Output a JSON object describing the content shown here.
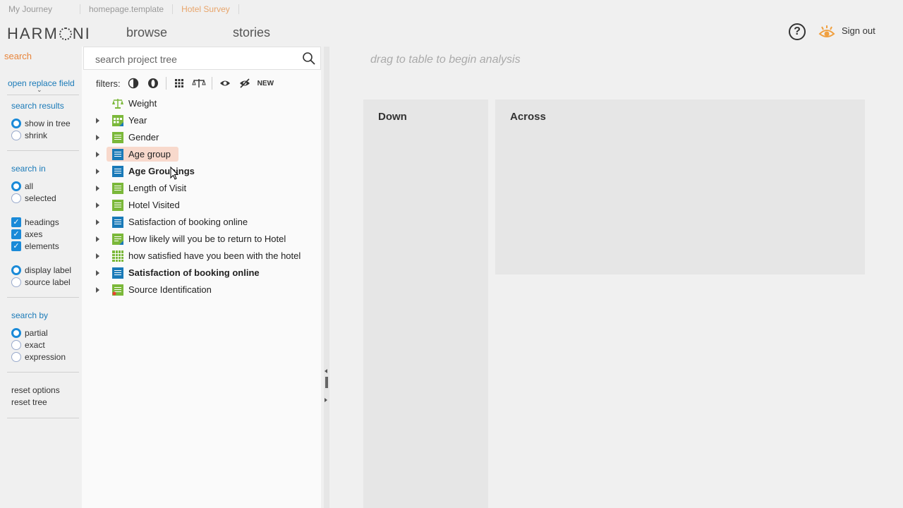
{
  "breadcrumbs": [
    "My Journey",
    "homepage.template",
    "Hotel Survey"
  ],
  "header": {
    "logo": "HARMONI",
    "nav": {
      "browse": "browse",
      "stories": "stories"
    },
    "help_icon": "question-circle-icon",
    "help_glyph": "?",
    "sign_out": "Sign out"
  },
  "options": {
    "title": "search",
    "open_replace": "open replace field",
    "search_results": {
      "heading": "search results",
      "items": [
        {
          "label": "show in tree",
          "selected": true
        },
        {
          "label": "shrink",
          "selected": false
        }
      ]
    },
    "search_in": {
      "heading": "search in",
      "items": [
        {
          "label": "all",
          "selected": true
        },
        {
          "label": "selected",
          "selected": false
        }
      ],
      "checks": [
        {
          "label": "headings",
          "checked": true
        },
        {
          "label": "axes",
          "checked": true
        },
        {
          "label": "elements",
          "checked": true
        }
      ],
      "label_items": [
        {
          "label": "display label",
          "selected": true
        },
        {
          "label": "source label",
          "selected": false
        }
      ]
    },
    "search_by": {
      "heading": "search by",
      "items": [
        {
          "label": "partial",
          "selected": true
        },
        {
          "label": "exact",
          "selected": false
        },
        {
          "label": "expression",
          "selected": false
        }
      ]
    },
    "reset_options": "reset options",
    "reset_tree": "reset tree"
  },
  "tree_panel": {
    "search_placeholder": "search project tree",
    "filters_label": "filters:",
    "new_label": "NEW",
    "items": [
      {
        "label": "Weight",
        "icon": "weight-scale-icon",
        "expandable": false,
        "bold": false
      },
      {
        "label": "Year",
        "icon": "calendar-grid-icon",
        "expandable": true,
        "bold": false
      },
      {
        "label": "Gender",
        "icon": "list-green-icon",
        "expandable": true,
        "bold": false
      },
      {
        "label": "Age group",
        "icon": "list-blue-icon",
        "expandable": true,
        "bold": false,
        "highlighted": true
      },
      {
        "label": "Age Groupings",
        "icon": "list-blue-icon",
        "expandable": true,
        "bold": true
      },
      {
        "label": "Length of Visit",
        "icon": "list-green-icon",
        "expandable": true,
        "bold": false
      },
      {
        "label": "Hotel Visited",
        "icon": "list-green-icon",
        "expandable": true,
        "bold": false
      },
      {
        "label": "Satisfaction of booking online",
        "icon": "list-blue-icon",
        "expandable": true,
        "bold": false
      },
      {
        "label": "How likely will you be to return to Hotel",
        "icon": "list-green-icon",
        "expandable": true,
        "bold": false
      },
      {
        "label": "how satisfied have you been with the hotel",
        "icon": "grid-green-icon",
        "expandable": true,
        "bold": false
      },
      {
        "label": "Satisfaction of booking online",
        "icon": "list-blue-icon",
        "expandable": true,
        "bold": true
      },
      {
        "label": "Source Identification",
        "icon": "list-green-icon",
        "expandable": true,
        "bold": false
      }
    ]
  },
  "analysis": {
    "hint": "drag to table to begin analysis",
    "down": "Down",
    "across": "Across"
  }
}
